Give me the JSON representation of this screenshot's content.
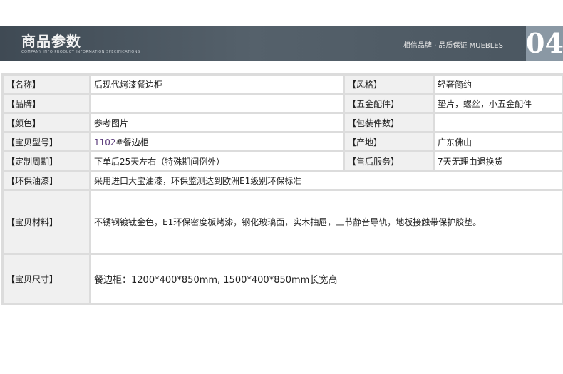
{
  "banner": {
    "title": "商品参数",
    "subtitle": "COMPANY INFO PRODUCT INFORMATION SPECIFICATIONS",
    "tagline": "相信品牌 · 品质保证   MUEBLES",
    "number": "04"
  },
  "rows": [
    {
      "label1": "【名称】",
      "value1": "后现代烤漆餐边柜",
      "label2": "【风格】",
      "value2": "轻奢简约"
    },
    {
      "label1": "【品牌】",
      "value1": "",
      "label2": "【五金配件】",
      "value2": "垫片，螺丝，小五金配件"
    },
    {
      "label1": "【颜色】",
      "value1": "参考图片",
      "label2": "【包装件数】",
      "value2": ""
    },
    {
      "label1": "【宝贝型号】",
      "value1_num": "1102",
      "value1_rest": "#餐边柜",
      "label2": "【产地】",
      "value2": "广东佛山"
    },
    {
      "label1": "【定制周期】",
      "value1": "下单后25天左右（特殊期间例外）",
      "label2": "【售后服务】",
      "value2": "7天无理由退换货"
    }
  ],
  "eco": {
    "label": "【环保油漆】",
    "value": "采用进口大宝油漆，环保监测达到欧洲E1级别环保标准"
  },
  "material": {
    "label": "【宝贝材料】",
    "value": "不锈钢镀钛金色，E1环保密度板烤漆，钢化玻璃面，实木抽屉，三节静音导轨，地板接触带保护胶垫。"
  },
  "size": {
    "label": "【宝贝尺寸】",
    "value": "餐边柜：1200*400*850mm, 1500*400*850mm长宽高"
  }
}
